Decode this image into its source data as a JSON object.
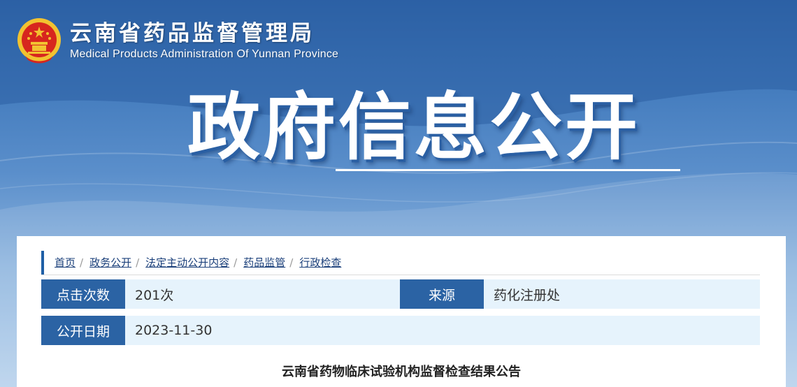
{
  "header": {
    "title_cn": "云南省药品监督管理局",
    "title_en": "Medical Products Administration Of Yunnan Province"
  },
  "hero": {
    "title": "政府信息公开"
  },
  "breadcrumb": [
    {
      "label": "首页"
    },
    {
      "label": "政务公开"
    },
    {
      "label": "法定主动公开内容"
    },
    {
      "label": "药品监管"
    },
    {
      "label": "行政检查"
    }
  ],
  "info": {
    "clicks_label": "点击次数",
    "clicks_value": "201次",
    "source_label": "来源",
    "source_value": "药化注册处",
    "date_label": "公开日期",
    "date_value": "2023-11-30"
  },
  "article": {
    "title": "云南省药物临床试验机构监督检查结果公告"
  },
  "colors": {
    "brand_blue": "#2b63a4",
    "row_bg": "#e6f3fc",
    "emblem_red": "#d7261e",
    "emblem_gold": "#f2c230"
  },
  "icons": {
    "emblem": "national-emblem-icon",
    "breadcrumb_marker": "vertical-bar"
  }
}
